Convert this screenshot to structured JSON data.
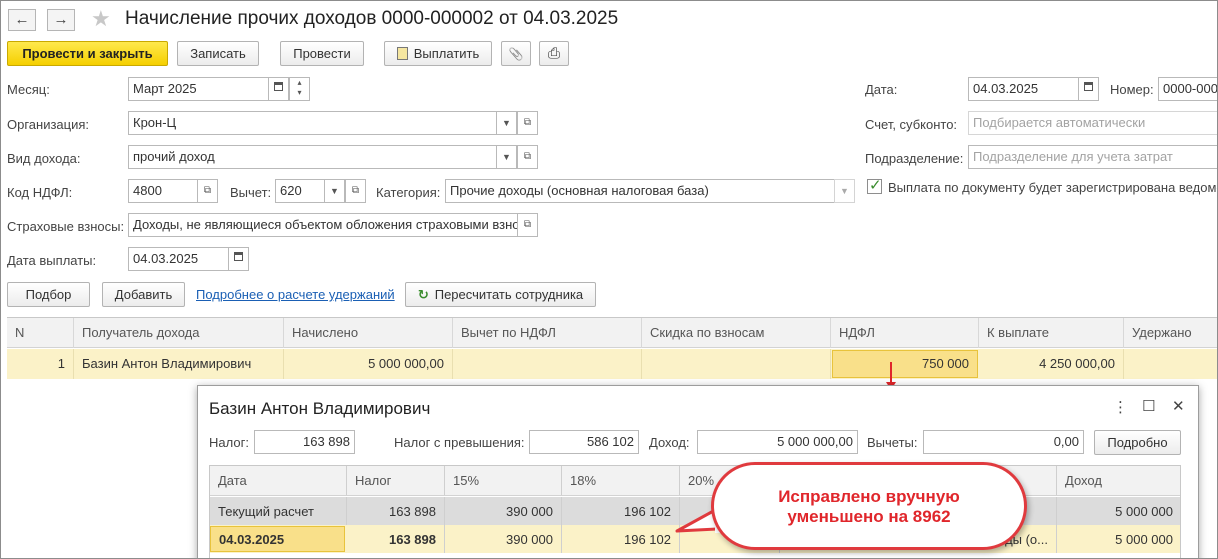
{
  "window": {
    "title": "Начисление прочих доходов 0000-000002 от 04.03.2025",
    "back_glyph": "←",
    "forward_glyph": "→",
    "favorite_glyph": "★"
  },
  "toolbar": {
    "post_close": "Провести и закрыть",
    "save": "Записать",
    "post": "Провести",
    "pay": "Выплатить",
    "attach_glyph": "📎",
    "print_glyph": "⎙"
  },
  "form": {
    "month_label": "Месяц:",
    "month_value": "Март 2025",
    "org_label": "Организация:",
    "org_value": "Крон-Ц",
    "income_type_label": "Вид дохода:",
    "income_type_value": "прочий доход",
    "ndfl_code_label": "Код НДФЛ:",
    "ndfl_code_value": "4800",
    "deduction_label": "Вычет:",
    "deduction_value": "620",
    "category_label": "Категория:",
    "category_value": "Прочие доходы (основная налоговая база)",
    "insurance_label": "Страховые взносы:",
    "insurance_value": "Доходы, не являющиеся объектом обложения страховыми взно",
    "pay_date_label": "Дата выплаты:",
    "pay_date_value": "04.03.2025",
    "date_label": "Дата:",
    "date_value": "04.03.2025",
    "number_label": "Номер:",
    "number_value": "0000-000",
    "account_label": "Счет, субконто:",
    "account_placeholder": "Подбирается автоматически",
    "division_label": "Подразделение:",
    "division_placeholder": "Подразделение для учета затрат",
    "registered_checkbox_label": "Выплата по документу будет зарегистрирована ведомо"
  },
  "actions": {
    "select": "Подбор",
    "add": "Добавить",
    "details_link": "Подробнее о расчете удержаний",
    "recalc": "Пересчитать сотрудника"
  },
  "table": {
    "columns": [
      "N",
      "Получатель дохода",
      "Начислено",
      "Вычет по НДФЛ",
      "Скидка по взносам",
      "НДФЛ",
      "К выплате",
      "Удержано"
    ],
    "rows": [
      {
        "n": "1",
        "recipient": "Базин Антон Владимирович",
        "accrued": "5 000 000,00",
        "deduction": "",
        "discount": "",
        "ndfl": "750 000",
        "payout": "4 250 000,00",
        "withheld": ""
      }
    ]
  },
  "popup": {
    "title": "Базин Антон Владимирович",
    "more_glyph": "⋮",
    "maximize_glyph": "☐",
    "close_glyph": "✕",
    "tax_label": "Налог:",
    "tax_value": "163 898",
    "excess_label": "Налог с превышения:",
    "excess_value": "586 102",
    "income_label": "Доход:",
    "income_value": "5 000 000,00",
    "deductions_label": "Вычеты:",
    "deductions_value": "0,00",
    "details_button": "Подробно",
    "columns": [
      "Дата",
      "Налог",
      "15%",
      "18%",
      "20%",
      "Доход"
    ],
    "rows": [
      {
        "date": "Текущий расчет",
        "tax": "163 898",
        "p15": "390 000",
        "p18": "196 102",
        "p20": "",
        "extra": "",
        "income": "5 000 000"
      },
      {
        "date": "04.03.2025",
        "tax": "163 898",
        "p15": "390 000",
        "p18": "196 102",
        "p20": "",
        "extra": "ды (о...",
        "income": "5 000 000"
      }
    ]
  },
  "callout": {
    "line1": "Исправлено вручную",
    "line2": "уменьшено на 8962"
  },
  "colors": {
    "primary_button": "#f5cf00",
    "selected_row": "#fbf2c8",
    "callout_red": "#e0262b",
    "link": "#1a5fb4",
    "checkbox_green": "#3a8c2d"
  }
}
